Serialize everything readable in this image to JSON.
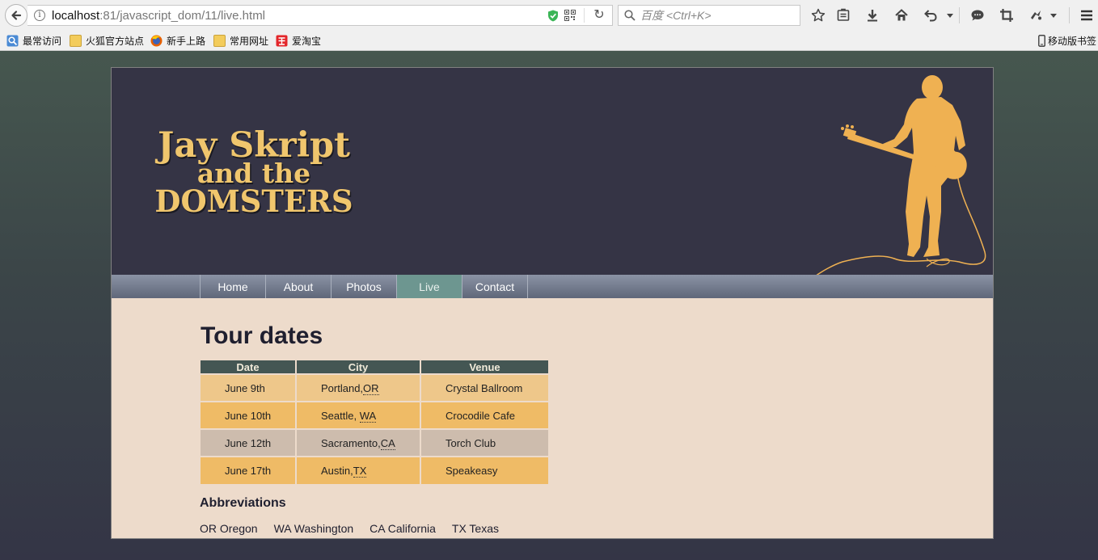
{
  "browser": {
    "url_host": "localhost",
    "url_rest": ":81/javascript_dom/11/live.html",
    "search_placeholder": "百度 <Ctrl+K>",
    "bookmarks": [
      "最常访问",
      "火狐官方站点",
      "新手上路",
      "常用网址",
      "爱淘宝"
    ],
    "mobile_bookmarks": "移动版书签"
  },
  "site": {
    "logo": {
      "line1": "Jay Skript",
      "line2": "and the",
      "line3": "DOMSTERS"
    },
    "nav": [
      {
        "label": "Home",
        "current": false
      },
      {
        "label": "About",
        "current": false
      },
      {
        "label": "Photos",
        "current": false
      },
      {
        "label": "Live",
        "current": true
      },
      {
        "label": "Contact",
        "current": false
      }
    ],
    "page_title": "Tour dates",
    "table": {
      "headers": [
        "Date",
        "City",
        "Venue"
      ],
      "rows": [
        {
          "date": "June 9th",
          "city": "Portland,",
          "state": "OR",
          "venue": "Crystal Ballroom"
        },
        {
          "date": "June 10th",
          "city": "Seattle, ",
          "state": "WA",
          "venue": "Crocodile Cafe"
        },
        {
          "date": "June 12th",
          "city": "Sacramento,",
          "state": "CA",
          "venue": "Torch Club"
        },
        {
          "date": "June 17th",
          "city": "Austin,",
          "state": "TX",
          "venue": "Speakeasy"
        }
      ]
    },
    "abbreviations_title": "Abbreviations",
    "abbreviations": [
      {
        "abbr": "OR",
        "full": "Oregon"
      },
      {
        "abbr": "WA",
        "full": "Washington"
      },
      {
        "abbr": "CA",
        "full": "California"
      },
      {
        "abbr": "TX",
        "full": "Texas"
      }
    ]
  },
  "colors": {
    "header_bg": "#353445",
    "logo_gold": "#f0c66d",
    "silhouette": "#efb152",
    "nav_current": "#6d9690",
    "content_bg": "#eddbcb",
    "table_header": "#445653"
  }
}
